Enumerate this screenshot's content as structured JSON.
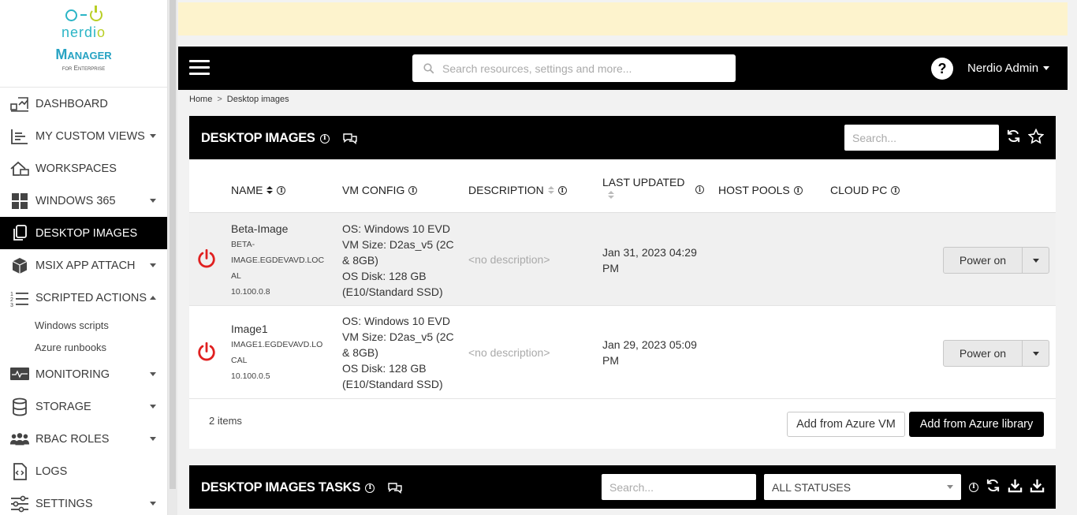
{
  "brand": {
    "name": "nerdio",
    "name_accent": "o",
    "product": "Manager",
    "edition": "for Enterprise"
  },
  "sidebar": {
    "items": [
      {
        "label": "DASHBOARD",
        "icon": "dashboard-icon"
      },
      {
        "label": "MY CUSTOM VIEWS",
        "icon": "custom-views-icon",
        "caret": "down"
      },
      {
        "label": "WORKSPACES",
        "icon": "workspaces-icon"
      },
      {
        "label": "WINDOWS 365",
        "icon": "windows-icon",
        "caret": "down"
      },
      {
        "label": "DESKTOP IMAGES",
        "icon": "desktop-images-icon",
        "active": true
      },
      {
        "label": "MSIX APP ATTACH",
        "icon": "package-icon",
        "caret": "down"
      },
      {
        "label": "SCRIPTED ACTIONS",
        "icon": "list-numbered-icon",
        "caret": "up"
      },
      {
        "label": "MONITORING",
        "icon": "monitoring-icon",
        "caret": "down"
      },
      {
        "label": "STORAGE",
        "icon": "database-icon",
        "caret": "down"
      },
      {
        "label": "RBAC ROLES",
        "icon": "users-icon",
        "caret": "down"
      },
      {
        "label": "LOGS",
        "icon": "logs-icon"
      },
      {
        "label": "SETTINGS",
        "icon": "sliders-icon",
        "caret": "down"
      }
    ],
    "sub_items": [
      "Windows scripts",
      "Azure runbooks"
    ]
  },
  "topbar": {
    "search_placeholder": "Search resources, settings and more...",
    "help": "?",
    "user": "Nerdio Admin"
  },
  "breadcrumb": {
    "home": "Home",
    "separator": ">",
    "current": "Desktop images"
  },
  "images_panel": {
    "title": "DESKTOP IMAGES",
    "search_placeholder": "Search...",
    "columns": [
      "NAME",
      "VM CONFIG",
      "DESCRIPTION",
      "LAST UPDATED",
      "HOST POOLS",
      "CLOUD PC"
    ],
    "rows": [
      {
        "name": "Beta-Image",
        "fqdn_1": "BETA-",
        "fqdn_2": "IMAGE.EGDEVAVD.LOC",
        "fqdn_3": "AL",
        "ip": "10.100.0.8",
        "vm_1": "OS: Windows 10 EVD",
        "vm_2": "VM Size: D2as_v5 (2C",
        "vm_3": "& 8GB)",
        "vm_4": "OS Disk: 128 GB",
        "vm_5": "(E10/Standard SSD)",
        "description": "<no description>",
        "updated_1": "Jan 31, 2023 04:29",
        "updated_2": "PM",
        "action": "Power on",
        "status_color": "#e02020"
      },
      {
        "name": "Image1",
        "fqdn_1": "IMAGE1.EGDEVAVD.LO",
        "fqdn_2": "CAL",
        "ip": "10.100.0.5",
        "vm_1": "OS: Windows 10 EVD",
        "vm_2": "VM Size: D2as_v5 (2C",
        "vm_3": "& 8GB)",
        "vm_4": "OS Disk: 128 GB",
        "vm_5": "(E10/Standard SSD)",
        "description": "<no description>",
        "updated_1": "Jan 29, 2023 05:09",
        "updated_2": "PM",
        "action": "Power on",
        "status_color": "#e02020"
      }
    ],
    "count": "2 items",
    "add_vm": "Add from Azure VM",
    "add_library": "Add from Azure library"
  },
  "tasks_panel": {
    "title": "DESKTOP IMAGES TASKS",
    "search_placeholder": "Search...",
    "status_filter": "ALL STATUSES"
  }
}
